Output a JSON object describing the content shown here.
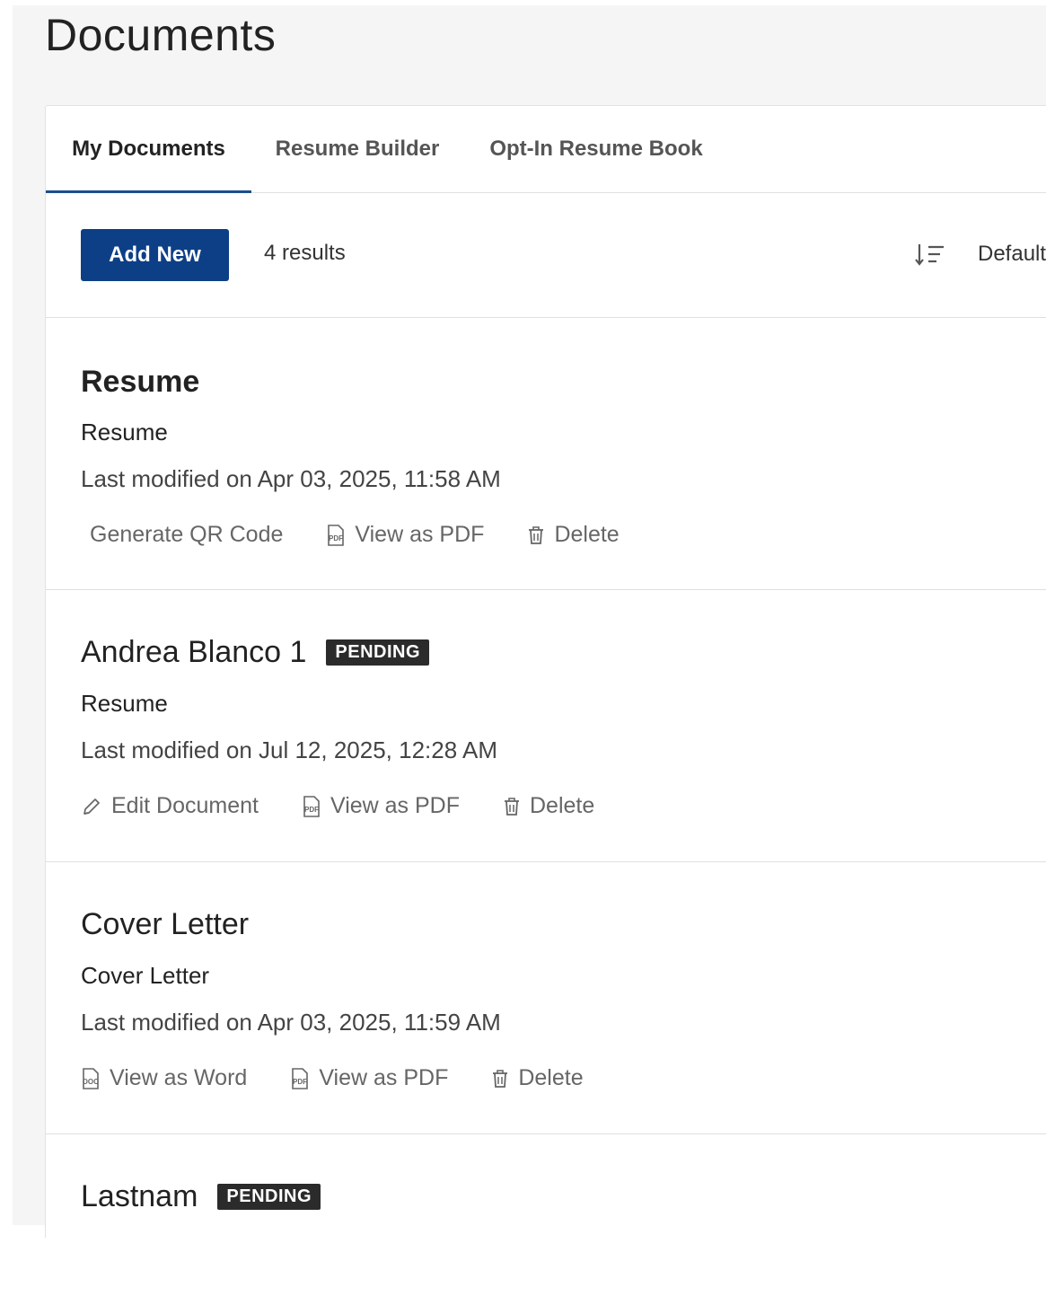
{
  "page": {
    "title": "Documents"
  },
  "tabs": [
    {
      "label": "My Documents",
      "active": true
    },
    {
      "label": "Resume Builder",
      "active": false
    },
    {
      "label": "Opt-In Resume Book",
      "active": false
    }
  ],
  "toolbar": {
    "add_new_label": "Add New",
    "results_text": "4 results",
    "sort_label": "Default",
    "sort_icon": "sort-icon"
  },
  "documents": [
    {
      "title": "Resume",
      "badge": null,
      "type": "Resume",
      "modified": "Last modified on Apr 03, 2025, 11:58 AM",
      "actions": [
        {
          "label": "Generate QR Code",
          "icon": null
        },
        {
          "label": "View as PDF",
          "icon": "pdf-icon"
        },
        {
          "label": "Delete",
          "icon": "trash-icon"
        }
      ]
    },
    {
      "title": "Andrea Blanco 1",
      "badge": "PENDING",
      "type": "Resume",
      "modified": "Last modified on Jul 12, 2025, 12:28 AM",
      "actions": [
        {
          "label": "Edit Document",
          "icon": "pencil-icon"
        },
        {
          "label": "View as PDF",
          "icon": "pdf-icon"
        },
        {
          "label": "Delete",
          "icon": "trash-icon"
        }
      ]
    },
    {
      "title": "Cover Letter",
      "badge": null,
      "type": "Cover Letter",
      "modified": "Last modified on Apr 03, 2025, 11:59 AM",
      "actions": [
        {
          "label": "View as Word",
          "icon": "doc-icon"
        },
        {
          "label": "View as PDF",
          "icon": "pdf-icon"
        },
        {
          "label": "Delete",
          "icon": "trash-icon"
        }
      ]
    },
    {
      "title": "Lastnam",
      "badge": "PENDING"
    }
  ],
  "colors": {
    "primary": "#0d3f86",
    "tab_indicator": "#1a4f8b",
    "badge_bg": "#2b2b2b",
    "page_bg": "#f5f5f5"
  }
}
